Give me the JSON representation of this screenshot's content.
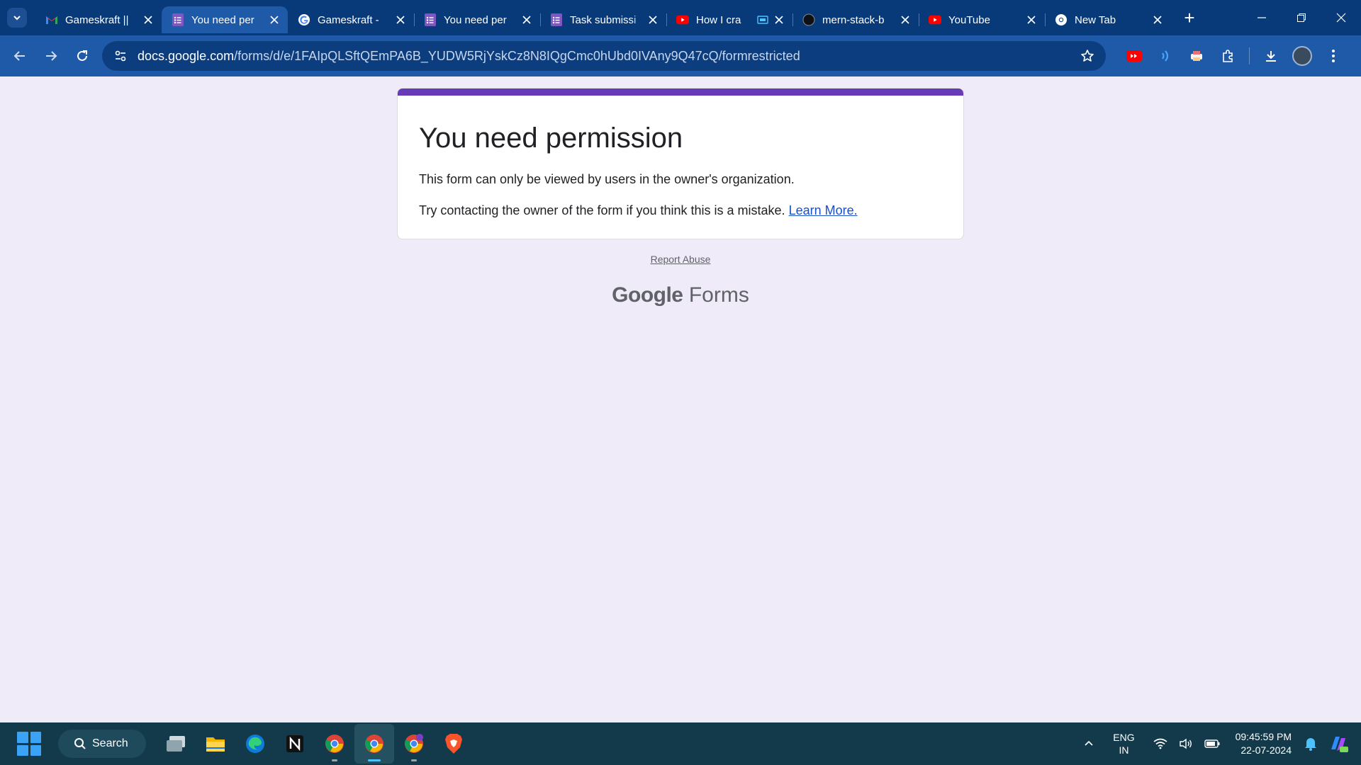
{
  "browser": {
    "tabs": [
      {
        "title": "Gameskraft ||",
        "icon": "gmail-icon",
        "active": false
      },
      {
        "title": "You need per",
        "icon": "google-forms-icon",
        "active": true
      },
      {
        "title": "Gameskraft -",
        "icon": "google-icon",
        "active": false
      },
      {
        "title": "You need per",
        "icon": "google-forms-icon",
        "active": false
      },
      {
        "title": "Task submissi",
        "icon": "google-forms-icon",
        "active": false
      },
      {
        "title": "How I cra",
        "icon": "youtube-icon",
        "active": false
      },
      {
        "title": "mern-stack-b",
        "icon": "github-icon",
        "active": false
      },
      {
        "title": "YouTube",
        "icon": "youtube-icon",
        "active": false
      },
      {
        "title": "New Tab",
        "icon": "chrome-icon",
        "active": false
      }
    ],
    "new_tab_label": "+",
    "url_domain": "docs.google.com",
    "url_path": "/forms/d/e/1FAIpQLSftQEmPA6B_YUDW5RjYskCz8N8IQgCmc0hUbd0IVAny9Q47cQ/formrestricted",
    "colors": {
      "tabstrip": "#083a7a",
      "toolbar": "#1f5aa8",
      "accent": "#673ab7"
    }
  },
  "page": {
    "title": "You need permission",
    "message1": "This form can only be viewed by users in the owner's organization.",
    "message2": "Try contacting the owner of the form if you think this is a mistake.",
    "learn_more": "Learn More.",
    "report_abuse": "Report Abuse",
    "logo_google": "Google",
    "logo_forms": "Forms"
  },
  "taskbar": {
    "search_label": "Search",
    "apps": [
      "task-view-icon",
      "file-explorer-icon",
      "edge-icon",
      "notion-icon",
      "chrome-icon",
      "chrome-icon",
      "chrome-icon",
      "brave-icon"
    ],
    "lang_top": "ENG",
    "lang_bottom": "IN",
    "time": "09:45:59 PM",
    "date": "22-07-2024"
  }
}
